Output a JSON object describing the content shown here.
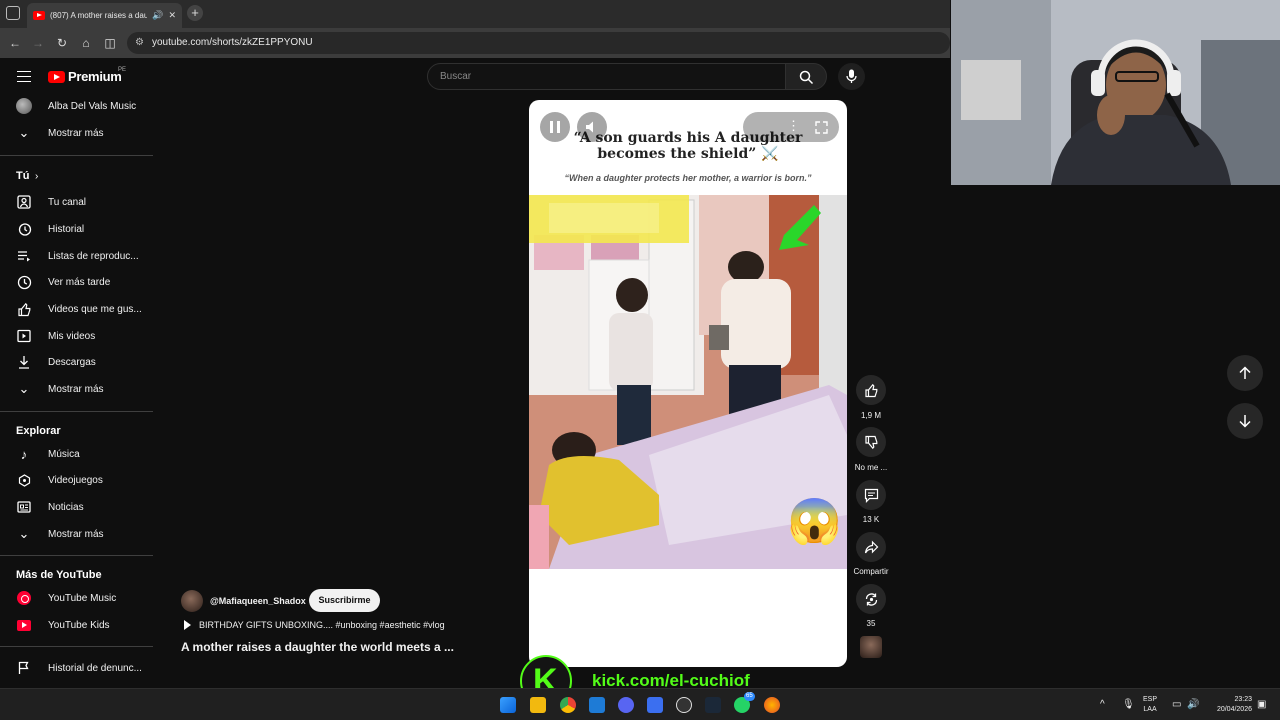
{
  "browser": {
    "tab_title": "(807) A mother raises a dau...",
    "url": "youtube.com/shorts/zkZE1PPYONU",
    "new_tab_symbol": "+",
    "close_symbol": "✕"
  },
  "youtube": {
    "brand": "Premium",
    "country": "PE",
    "search_placeholder": "Buscar"
  },
  "sidebar": {
    "top_items": [
      {
        "label": "Alba Del Vals Music",
        "icon": "channel-avatar"
      },
      {
        "label": "Mostrar más",
        "icon": "chevron-down-icon"
      }
    ],
    "you_heading": "Tú",
    "you_items": [
      {
        "label": "Tu canal",
        "icon": "channel-icon"
      },
      {
        "label": "Historial",
        "icon": "history-icon"
      },
      {
        "label": "Listas de reproduc...",
        "icon": "playlists-icon"
      },
      {
        "label": "Ver más tarde",
        "icon": "clock-icon"
      },
      {
        "label": "Videos que me gus...",
        "icon": "thumb-up-icon"
      },
      {
        "label": "Mis videos",
        "icon": "video-icon"
      },
      {
        "label": "Descargas",
        "icon": "download-icon"
      },
      {
        "label": "Mostrar más",
        "icon": "chevron-down-icon"
      }
    ],
    "explore_heading": "Explorar",
    "explore_items": [
      {
        "label": "Música",
        "icon": "music-icon"
      },
      {
        "label": "Videojuegos",
        "icon": "gaming-icon"
      },
      {
        "label": "Noticias",
        "icon": "news-icon"
      },
      {
        "label": "Mostrar más",
        "icon": "chevron-down-icon"
      }
    ],
    "more_heading": "Más de YouTube",
    "more_items": [
      {
        "label": "YouTube Music",
        "icon": "youtube-music-icon"
      },
      {
        "label": "YouTube Kids",
        "icon": "youtube-kids-icon"
      }
    ],
    "report_item": {
      "label": "Historial de denunc...",
      "icon": "flag-icon"
    }
  },
  "short": {
    "title_line1": "“A son guards his  A daughter",
    "title_line2": "becomes the shield” ⚔️",
    "subtitle": "“When a daughter protects her mother, a warrior is born.”",
    "reaction_emoji": "😱"
  },
  "actions": {
    "like_count": "1,9 M",
    "dislike_label": "No me ...",
    "comment_count": "13 K",
    "share_label": "Compartir",
    "remix_count": "35"
  },
  "channel": {
    "handle": "@Mafiaqueen_Shadox",
    "subscribe_label": "Suscribirme",
    "description": "BIRTHDAY GIFTS UNBOXING.... #unboxing #aesthetic #vlog",
    "video_title": "A mother raises a daughter the world meets a ..."
  },
  "overlay": {
    "kick_letter": "K",
    "kick_url": "kick.com/el-cuchiof"
  },
  "taskbar": {
    "lang_line1": "ESP",
    "lang_line2": "LAA",
    "time": "23:23",
    "date": "20/04/2026",
    "whatsapp_badge": "65"
  },
  "colors": {
    "youtube_red": "#ff0000",
    "kick_green": "#53fc18",
    "background": "#0f0f0f"
  }
}
